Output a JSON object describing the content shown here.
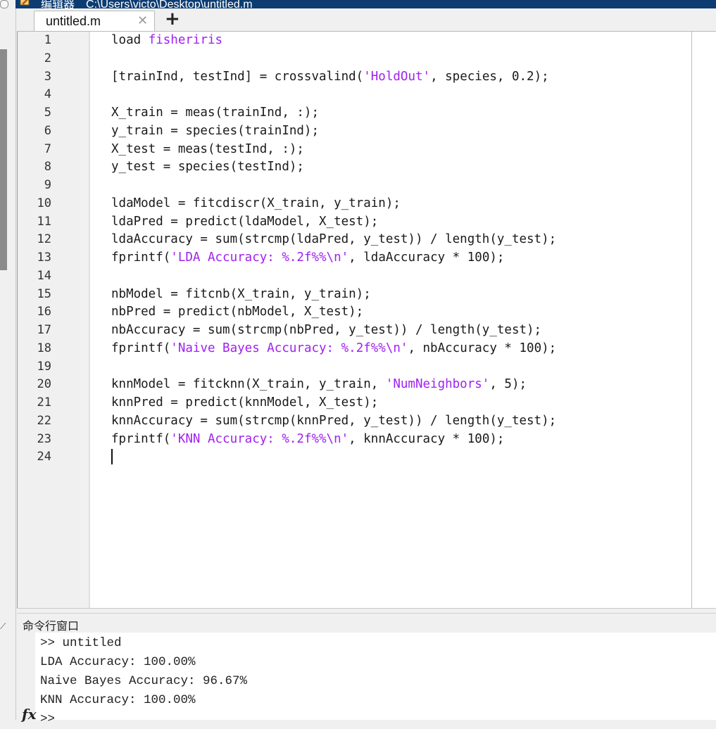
{
  "window": {
    "title_label": "编辑器",
    "title_path": "C:\\Users\\victo\\Desktop\\untitled.m"
  },
  "tabs": [
    {
      "label": "untitled.m",
      "close_symbol": "✕"
    }
  ],
  "tab_add_symbol": "+",
  "editor": {
    "lines": [
      {
        "num": "1",
        "parts": [
          {
            "t": "load "
          },
          {
            "t": "fisheriris",
            "s": true
          }
        ]
      },
      {
        "num": "2",
        "parts": []
      },
      {
        "num": "3",
        "parts": [
          {
            "t": "[trainInd, testInd] = crossvalind("
          },
          {
            "t": "'HoldOut'",
            "s": true
          },
          {
            "t": ", species, 0.2);"
          }
        ]
      },
      {
        "num": "4",
        "parts": []
      },
      {
        "num": "5",
        "parts": [
          {
            "t": "X_train = meas(trainInd, :);"
          }
        ]
      },
      {
        "num": "6",
        "parts": [
          {
            "t": "y_train = species(trainInd);"
          }
        ]
      },
      {
        "num": "7",
        "parts": [
          {
            "t": "X_test = meas(testInd, :);"
          }
        ]
      },
      {
        "num": "8",
        "parts": [
          {
            "t": "y_test = species(testInd);"
          }
        ]
      },
      {
        "num": "9",
        "parts": []
      },
      {
        "num": "10",
        "parts": [
          {
            "t": "ldaModel = fitcdiscr(X_train, y_train);"
          }
        ]
      },
      {
        "num": "11",
        "parts": [
          {
            "t": "ldaPred = predict(ldaModel, X_test);"
          }
        ]
      },
      {
        "num": "12",
        "parts": [
          {
            "t": "ldaAccuracy = sum(strcmp(ldaPred, y_test)) / length(y_test);"
          }
        ]
      },
      {
        "num": "13",
        "parts": [
          {
            "t": "fprintf("
          },
          {
            "t": "'LDA Accuracy: %.2f%%\\n'",
            "s": true
          },
          {
            "t": ", ldaAccuracy * 100);"
          }
        ]
      },
      {
        "num": "14",
        "parts": []
      },
      {
        "num": "15",
        "parts": [
          {
            "t": "nbModel = fitcnb(X_train, y_train);"
          }
        ]
      },
      {
        "num": "16",
        "parts": [
          {
            "t": "nbPred = predict(nbModel, X_test);"
          }
        ]
      },
      {
        "num": "17",
        "parts": [
          {
            "t": "nbAccuracy = sum(strcmp(nbPred, y_test)) / length(y_test);"
          }
        ]
      },
      {
        "num": "18",
        "parts": [
          {
            "t": "fprintf("
          },
          {
            "t": "'Naive Bayes Accuracy: %.2f%%\\n'",
            "s": true
          },
          {
            "t": ", nbAccuracy * 100);"
          }
        ]
      },
      {
        "num": "19",
        "parts": []
      },
      {
        "num": "20",
        "parts": [
          {
            "t": "knnModel = fitcknn(X_train, y_train, "
          },
          {
            "t": "'NumNeighbors'",
            "s": true
          },
          {
            "t": ", 5);"
          }
        ]
      },
      {
        "num": "21",
        "parts": [
          {
            "t": "knnPred = predict(knnModel, X_test);"
          }
        ]
      },
      {
        "num": "22",
        "parts": [
          {
            "t": "knnAccuracy = sum(strcmp(knnPred, y_test)) / length(y_test);"
          }
        ]
      },
      {
        "num": "23",
        "parts": [
          {
            "t": "fprintf("
          },
          {
            "t": "'KNN Accuracy: %.2f%%\\n'",
            "s": true
          },
          {
            "t": ", knnAccuracy * 100);"
          }
        ]
      },
      {
        "num": "24",
        "parts": []
      }
    ],
    "string_color": "#a020f0",
    "text_color": "#1a1a1a"
  },
  "command_window": {
    "title": "命令行窗口",
    "lines": [
      ">> untitled",
      "LDA Accuracy: 100.00%",
      "Naive Bayes Accuracy: 96.67%",
      "KNN Accuracy: 100.00%"
    ],
    "prompt": ">>",
    "fx_icon": "fx"
  },
  "colors": {
    "title_bar": "#0c3c72",
    "panel_bg": "#f0f0f0"
  }
}
